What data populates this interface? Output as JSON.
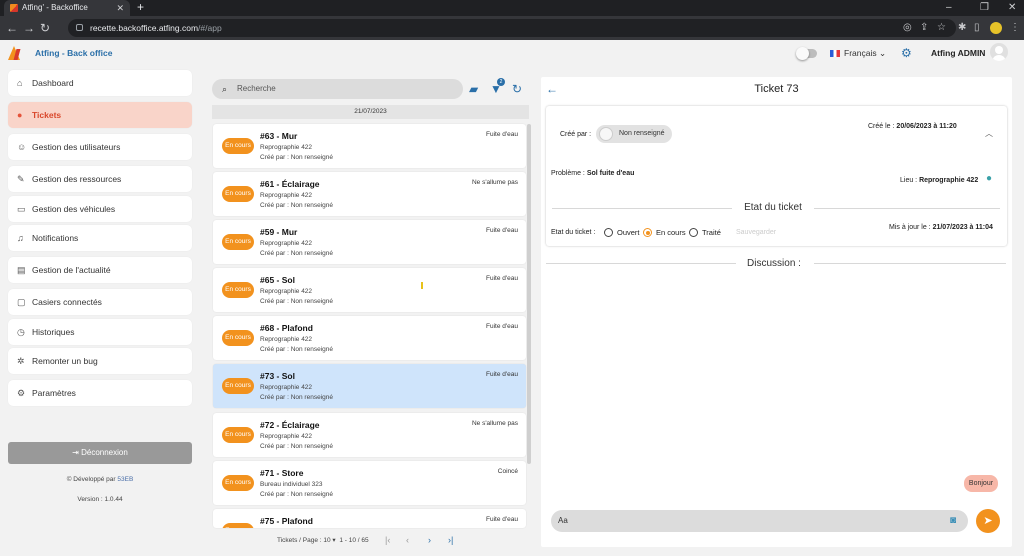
{
  "browser": {
    "tab_title": "Atfing' - Backoffice",
    "url_host": "recette.backoffice.atfing.com",
    "url_path": "/#/app"
  },
  "header": {
    "app_title": "Atfing - Back office",
    "language": "Français",
    "user_name": "Atfing ADMIN"
  },
  "sidebar": {
    "items": [
      {
        "label": "Dashboard",
        "icon": "home-icon"
      },
      {
        "label": "Tickets",
        "icon": "alert-icon"
      },
      {
        "label": "Gestion des utilisateurs",
        "icon": "user-icon"
      },
      {
        "label": "Gestion des ressources",
        "icon": "edit-icon"
      },
      {
        "label": "Gestion des véhicules",
        "icon": "truck-icon"
      },
      {
        "label": "Notifications",
        "icon": "bell-icon"
      },
      {
        "label": "Gestion de l'actualité",
        "icon": "news-icon"
      },
      {
        "label": "Casiers connectés",
        "icon": "locker-icon"
      },
      {
        "label": "Historiques",
        "icon": "history-icon"
      },
      {
        "label": "Remonter un bug",
        "icon": "bug-icon"
      },
      {
        "label": "Paramètres",
        "icon": "settings-icon"
      }
    ],
    "logout_label": "Déconnexion",
    "dev_by": "Développé par",
    "dev_brand": "53EB",
    "version": "Version : 1.0.44"
  },
  "list": {
    "search_placeholder": "Recherche",
    "filter_badge": "2",
    "date_header": "21/07/2023",
    "tickets": [
      {
        "status": "En cours",
        "title": "#63 - Mur",
        "location": "Reprographie 422",
        "created_by": "Créé par : Non renseigné",
        "type": "Fuite d'eau"
      },
      {
        "status": "En cours",
        "title": "#61 - Éclairage",
        "location": "Reprographie 422",
        "created_by": "Créé par : Non renseigné",
        "type": "Ne s'allume pas"
      },
      {
        "status": "En cours",
        "title": "#59 - Mur",
        "location": "Reprographie 422",
        "created_by": "Créé par : Non renseigné",
        "type": "Fuite d'eau"
      },
      {
        "status": "En cours",
        "title": "#65 - Sol",
        "location": "Reprographie 422",
        "created_by": "Créé par : Non renseigné",
        "type": "Fuite d'eau"
      },
      {
        "status": "En cours",
        "title": "#68 - Plafond",
        "location": "Reprographie 422",
        "created_by": "Créé par : Non renseigné",
        "type": "Fuite d'eau"
      },
      {
        "status": "En cours",
        "title": "#73 - Sol",
        "location": "Reprographie 422",
        "created_by": "Créé par : Non renseigné",
        "type": "Fuite d'eau"
      },
      {
        "status": "En cours",
        "title": "#72 - Éclairage",
        "location": "Reprographie 422",
        "created_by": "Créé par : Non renseigné",
        "type": "Ne s'allume pas"
      },
      {
        "status": "En cours",
        "title": "#71 - Store",
        "location": "Bureau individuel 323",
        "created_by": "Créé par : Non renseigné",
        "type": "Coincé"
      },
      {
        "status": "En cours",
        "title": "#75 - Plafond",
        "location": "",
        "created_by": "",
        "type": "Fuite d'eau"
      }
    ],
    "pager_label": "Tickets / Page :",
    "page_size": "10",
    "page_range": "1 - 10 / 65"
  },
  "detail": {
    "title": "Ticket 73",
    "created_by_label": "Créé par :",
    "created_by_value": "Non renseigné",
    "created_on_label": "Créé le :",
    "created_on_value": "20/06/2023 à 11:20",
    "problem_label": "Problème :",
    "problem_value": "Sol fuite d'eau",
    "place_label": "Lieu :",
    "place_value": "Reprographie 422",
    "state_section": "Etat du ticket",
    "state_label": "Etat du ticket :",
    "states": [
      "Ouvert",
      "En cours",
      "Traité"
    ],
    "selected_state": "En cours",
    "ghost_text": "Sauvegarder",
    "updated_label": "Mis à jour le :",
    "updated_value": "21/07/2023 à 11:04",
    "discussion_title": "Discussion :",
    "messages": [
      "Bonjour"
    ],
    "message_input": "Aa"
  },
  "colors": {
    "accent_orange": "#f2921e",
    "primary_blue": "#2a6fa8",
    "active_bg": "#f9d4c9",
    "selected_card": "#cfe4fb"
  }
}
